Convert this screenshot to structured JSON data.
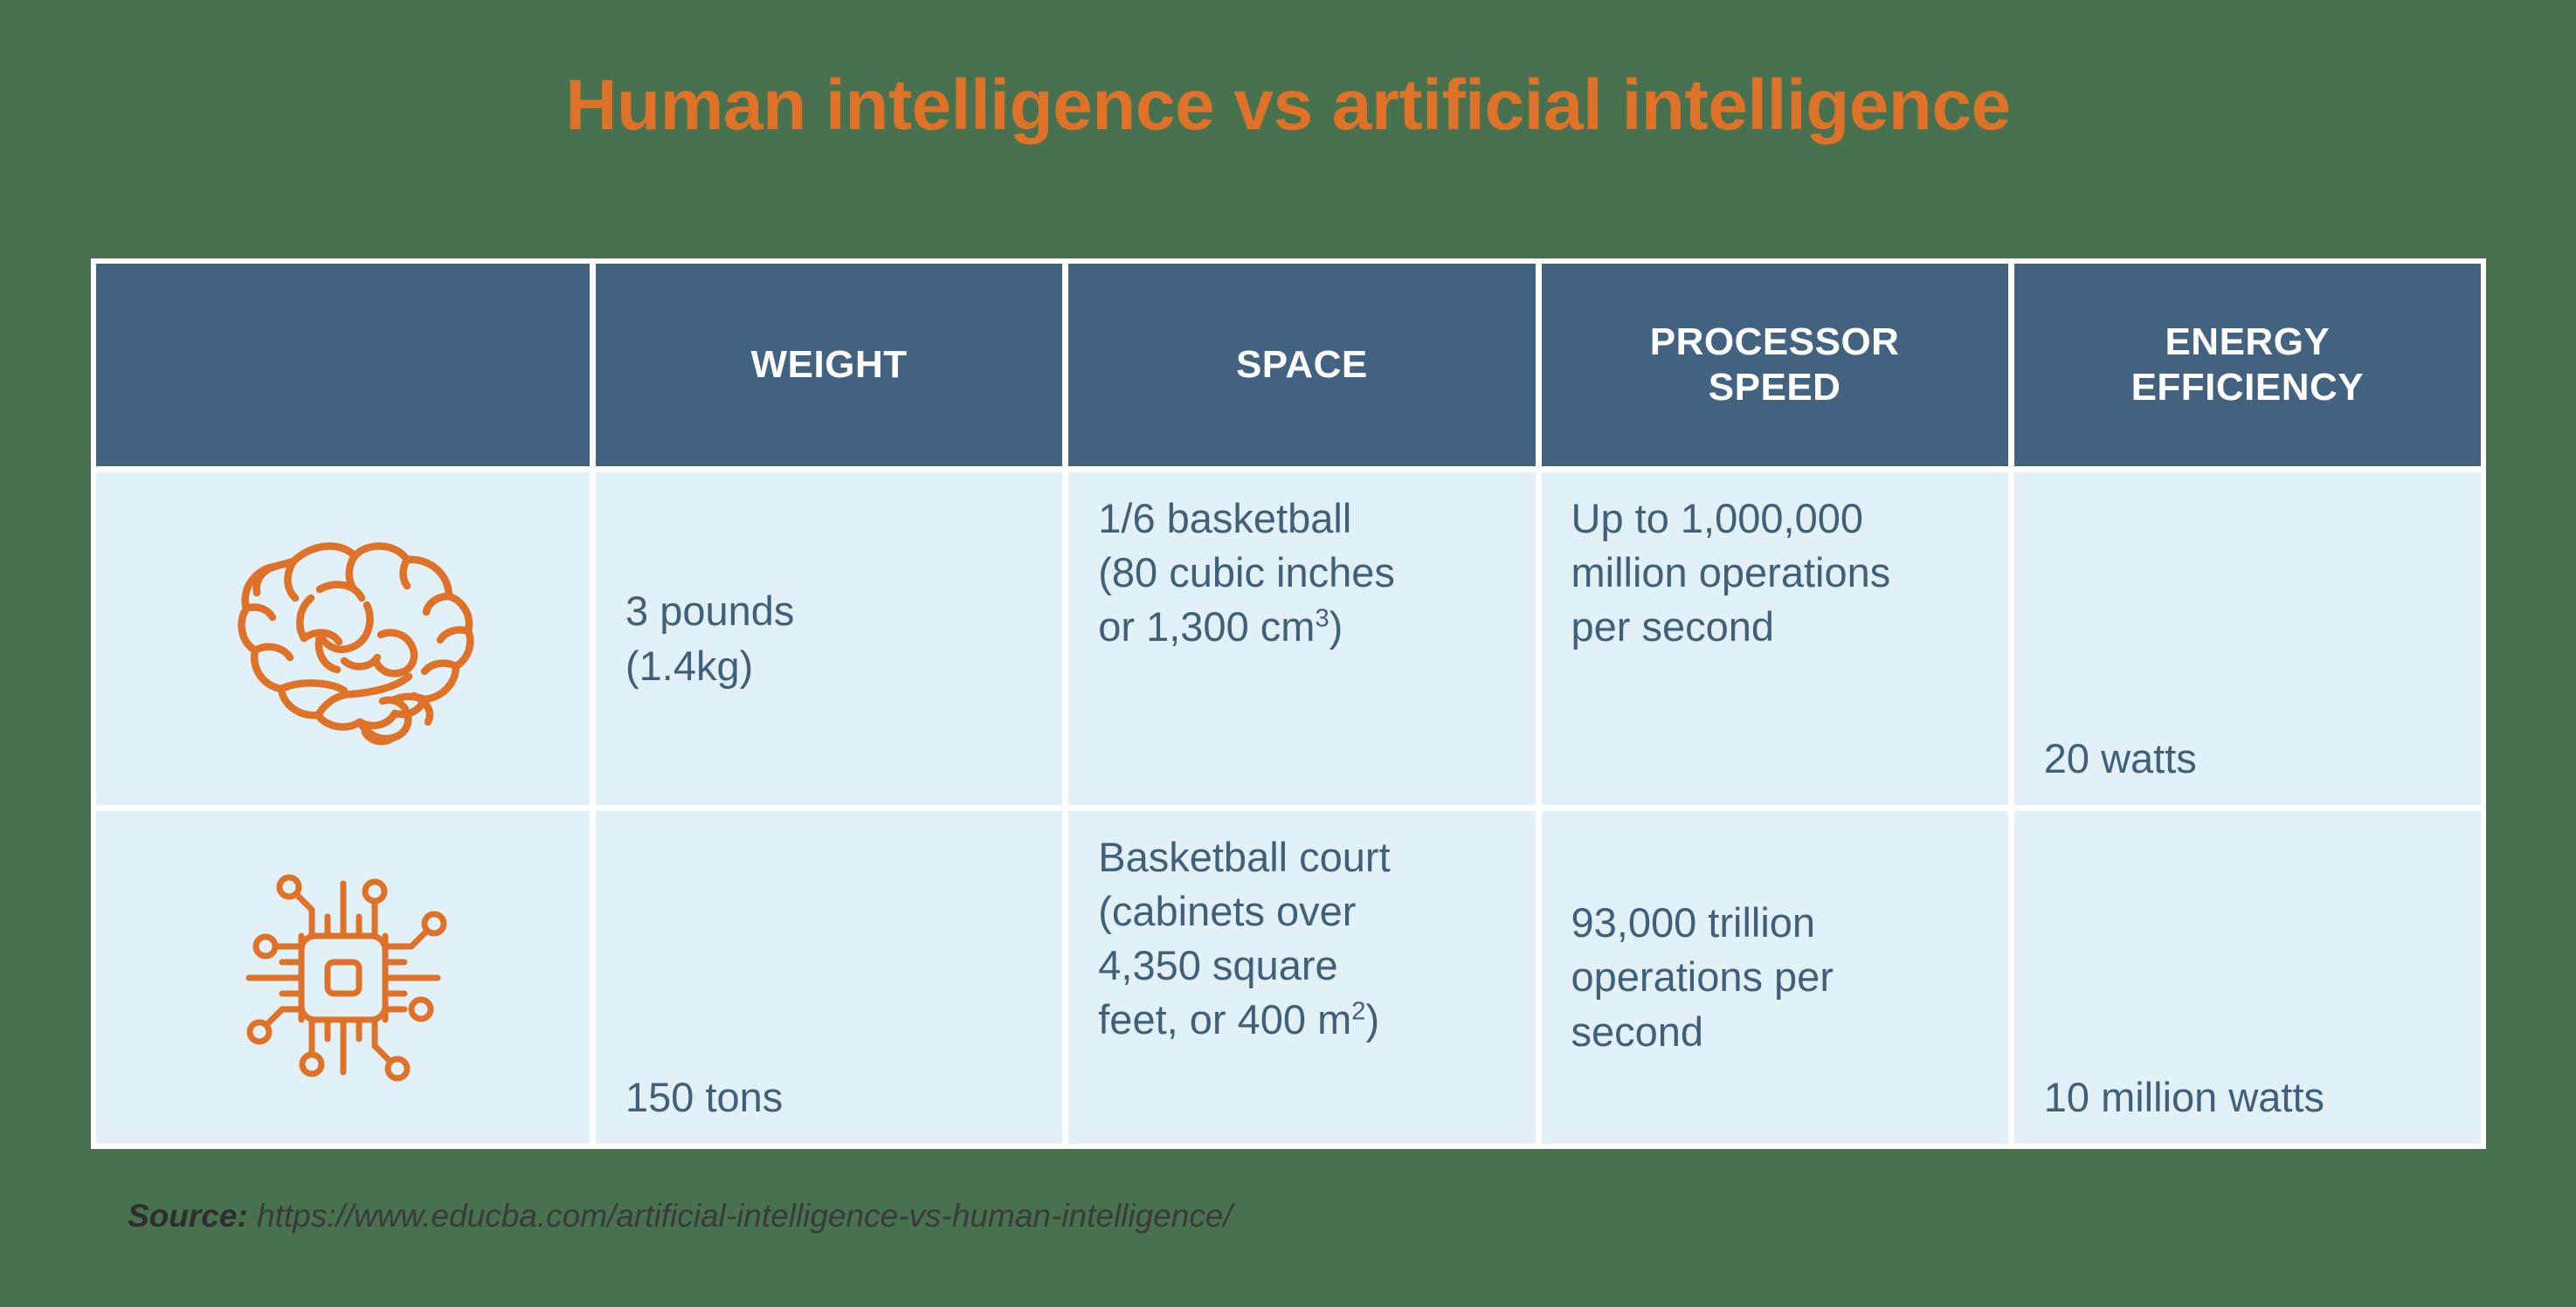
{
  "title": "Human intelligence vs artificial intelligence",
  "colors": {
    "background": "#48714F",
    "accent_orange": "#DE7229",
    "header_blue": "#43627F",
    "cell_blue": "#E2F0F8",
    "body_text": "#3F6078",
    "border_white": "#FFFFFF"
  },
  "table": {
    "headers": [
      {
        "label": "",
        "name": "header-blank"
      },
      {
        "label": "WEIGHT",
        "name": "header-weight"
      },
      {
        "label": "SPACE",
        "name": "header-space"
      },
      {
        "label_line1": "PROCESSOR",
        "label_line2": "SPEED",
        "name": "header-processor-speed"
      },
      {
        "label_line1": "ENERGY",
        "label_line2": "EFFICIENCY",
        "name": "header-energy-efficiency"
      }
    ],
    "rows": [
      {
        "icon": "brain-icon",
        "icon_label": "Human brain",
        "weight": "3 pounds\n(1.4kg)",
        "weight_line1": "3 pounds",
        "weight_line2": "(1.4kg)",
        "space_line1": "1/6 basketball",
        "space_line2": "(80 cubic inches",
        "space_line3_pre": "or 1,300 cm",
        "space_line3_sup": "3",
        "space_line3_post": ")",
        "processor_line1": "Up to 1,000,000",
        "processor_line2": "million operations",
        "processor_line3": "per second",
        "energy": "20 watts"
      },
      {
        "icon": "microchip-icon",
        "icon_label": "Artificial intelligence processor",
        "weight": "150 tons",
        "space_line1": "Basketball court",
        "space_line2": "(cabinets over",
        "space_line3": "4,350 square",
        "space_line4_pre": "feet, or 400 m",
        "space_line4_sup": "2",
        "space_line4_post": ")",
        "processor_line1": "93,000 trillion",
        "processor_line2": "operations per",
        "processor_line3": "second",
        "energy": "10 million watts"
      }
    ]
  },
  "source": {
    "label": "Source:",
    "url": "https://www.educba.com/artificial-intelligence-vs-human-intelligence/"
  }
}
